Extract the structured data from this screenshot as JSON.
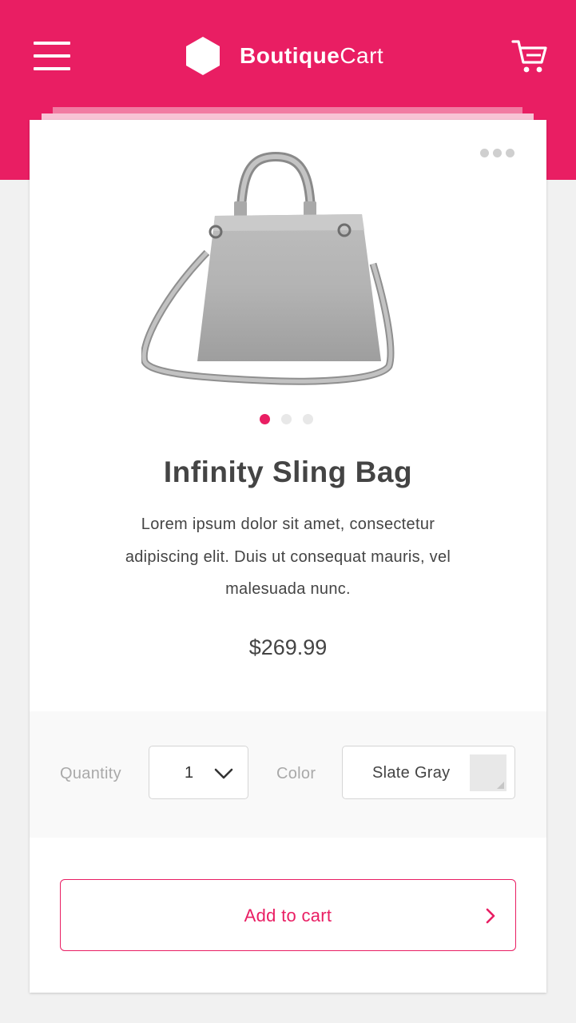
{
  "app": {
    "brand_bold": "Boutique",
    "brand_regular": "Cart",
    "brand_color": "#e91e63"
  },
  "product": {
    "name": "Infinity Sling Bag",
    "description": "Lorem ipsum dolor sit amet, consectetur adipiscing elit. Duis ut consequat mauris, vel malesuada nunc.",
    "price": "$269.99",
    "image_slides": 3,
    "active_slide": 1
  },
  "options": {
    "quantity_label": "Quantity",
    "quantity_value": "1",
    "color_label": "Color",
    "color_value": "Slate Gray",
    "swatch_color": "#e8e8e8"
  },
  "actions": {
    "add_to_cart": "Add to cart"
  },
  "icons": [
    "menu-icon",
    "logo-hexagon-icon",
    "cart-icon",
    "more-dots-icon",
    "chevron-down-icon",
    "chevron-right-icon"
  ]
}
